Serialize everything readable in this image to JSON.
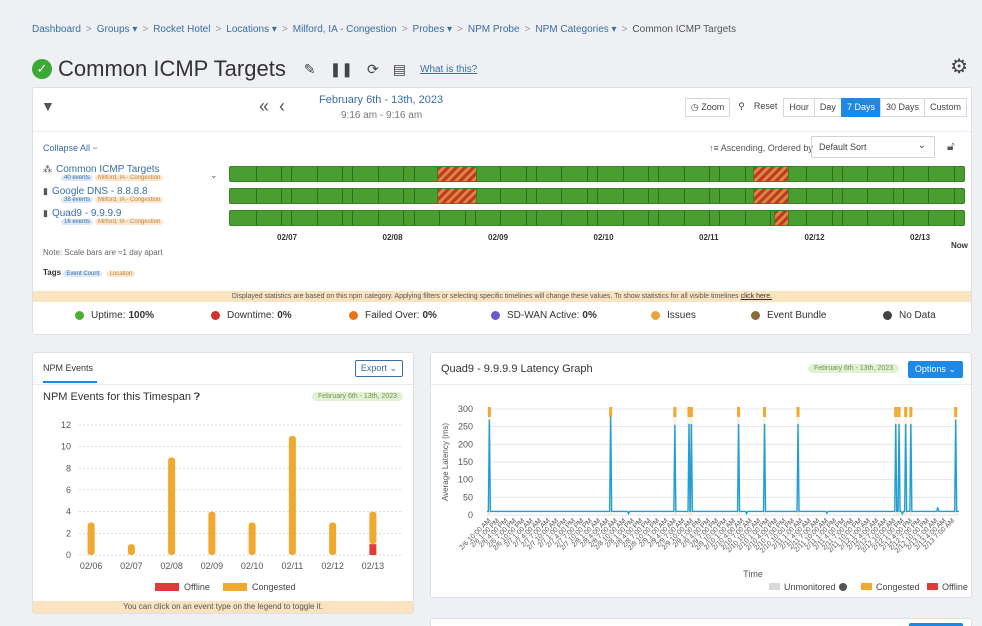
{
  "breadcrumb": [
    {
      "label": "Dashboard",
      "dropdown": false
    },
    {
      "label": "Groups",
      "dropdown": true
    },
    {
      "label": "Rocket Hotel",
      "dropdown": false
    },
    {
      "label": "Locations",
      "dropdown": true
    },
    {
      "label": "Milford, IA - Congestion",
      "dropdown": false
    },
    {
      "label": "Probes",
      "dropdown": true
    },
    {
      "label": "NPM Probe",
      "dropdown": false
    },
    {
      "label": "NPM Categories",
      "dropdown": true
    },
    {
      "label": "Common ICMP Targets",
      "dropdown": false
    }
  ],
  "page": {
    "title": "Common ICMP Targets",
    "what_is_this": "What is this?"
  },
  "timeline": {
    "date_range": "February 6th - 13th, 2023",
    "time_range": "9:16 am - 9:16 am",
    "zoom_label": "Zoom",
    "reset_label": "Reset",
    "ranges": [
      "Hour",
      "Day",
      "7 Days",
      "30 Days",
      "Custom"
    ],
    "active_range": "7 Days",
    "collapse_label": "Collapse All",
    "sort_label": "Ascending, Ordered by",
    "sort_value": "Default Sort",
    "targets": [
      {
        "name": "Common ICMP Targets",
        "events": "40 events",
        "location": "Milford, IA - Congestion",
        "issues": [
          [
            0.282,
            0.336
          ],
          [
            0.712,
            0.761
          ]
        ]
      },
      {
        "name": "Google DNS - 8.8.8.8",
        "events": "38 events",
        "location": "Milford, IA - Congestion",
        "issues": [
          [
            0.282,
            0.336
          ],
          [
            0.712,
            0.761
          ]
        ]
      },
      {
        "name": "Quad9 - 9.9.9.9",
        "events": "16 events",
        "location": "Milford, IA - Congestion",
        "issues": [
          [
            0.741,
            0.761
          ]
        ]
      }
    ],
    "axis_labels": [
      "02/07",
      "02/08",
      "02/09",
      "02/10",
      "02/11",
      "02/12",
      "02/13",
      "Now"
    ],
    "scale_note": "Note: Scale bars are ≈1 day apart",
    "tags_label": "Tags",
    "tag_event_count": "Event Count",
    "tag_location": "Location",
    "banner_text": "Displayed statistics are based on this npm category. Applying filters or selecting specific timelines will change these values. To show statistics for all visible timelines",
    "banner_link": "click here.",
    "stats": [
      {
        "label": "Uptime:",
        "value": "100%",
        "color": "#4caf2f"
      },
      {
        "label": "Downtime:",
        "value": "0%",
        "color": "#d32f2f"
      },
      {
        "label": "Failed Over:",
        "value": "0%",
        "color": "#e8711c"
      },
      {
        "label": "SD-WAN Active:",
        "value": "0%",
        "color": "#6a5acd"
      },
      {
        "label": "Issues",
        "value": "",
        "color": "#e8a33a"
      },
      {
        "label": "Event Bundle",
        "value": "",
        "color": "#8b6a3a"
      },
      {
        "label": "No Data",
        "value": "",
        "color": "#444444"
      }
    ]
  },
  "events_panel": {
    "tab_label": "NPM Events",
    "export_label": "Export",
    "title": "NPM Events for this Timespan",
    "date_pill": "February 6th - 13th, 2023",
    "footer": "You can click on an event type on the legend to toggle it."
  },
  "latency_panel": {
    "title": "Quad9 - 9.9.9.9 Latency Graph",
    "date_pill": "February 6th - 13th, 2023",
    "options_label": "Options"
  },
  "chart_data": [
    {
      "type": "bar",
      "title": "NPM Events for this Timespan",
      "categories": [
        "02/06",
        "02/07",
        "02/08",
        "02/09",
        "02/10",
        "02/11",
        "02/12",
        "02/13"
      ],
      "series": [
        {
          "name": "Offline",
          "color": "#e03a3a",
          "values": [
            0,
            0,
            0,
            0,
            0,
            0,
            0,
            1
          ]
        },
        {
          "name": "Congested",
          "color": "#f0a92e",
          "values": [
            3,
            1,
            9,
            4,
            3,
            11,
            3,
            3
          ]
        }
      ],
      "ylim": [
        0,
        12
      ],
      "yticks": [
        0,
        2,
        4,
        6,
        8,
        10,
        12
      ],
      "stacked": true,
      "legend": "bottom",
      "grid": true
    },
    {
      "type": "line",
      "title": "Quad9 - 9.9.9.9 Latency Graph",
      "xlabel": "Time",
      "ylabel": "Average Latency (ms)",
      "ylim": [
        0,
        300
      ],
      "yticks": [
        0,
        50,
        100,
        150,
        200,
        250,
        300
      ],
      "x_ticks": [
        "2/6 10:00 AM",
        "2/6 1:00 PM",
        "2/6 4:00 PM",
        "2/6 7:00 PM",
        "2/6 10:00 PM",
        "2/7 1:00 AM",
        "2/7 4:00 AM",
        "2/7 7:00 AM",
        "2/7 10:00 AM",
        "2/7 1:00 PM",
        "2/7 4:00 PM",
        "2/7 7:00 PM",
        "2/7 10:00 PM",
        "2/8 1:00 AM",
        "2/8 4:00 AM",
        "2/8 7:00 AM",
        "2/8 10:00 AM",
        "2/8 1:00 PM",
        "2/8 4:00 PM",
        "2/8 7:00 PM",
        "2/8 10:00 PM",
        "2/9 1:00 AM",
        "2/9 4:00 AM",
        "2/9 7:00 AM",
        "2/9 10:00 AM",
        "2/9 1:00 PM",
        "2/9 4:00 PM",
        "2/9 7:00 PM",
        "2/9 10:00 PM",
        "2/10 1:00 AM",
        "2/10 4:00 AM",
        "2/10 7:00 AM",
        "2/10 10:00 AM",
        "2/10 1:00 PM",
        "2/10 4:00 PM",
        "2/10 7:00 PM",
        "2/10 10:00 PM",
        "2/11 1:00 AM",
        "2/11 4:00 AM",
        "2/11 7:00 AM",
        "2/11 10:00 AM",
        "2/11 1:00 PM",
        "2/11 4:00 PM",
        "2/11 7:00 PM",
        "2/11 10:00 PM",
        "2/12 1:00 AM",
        "2/12 4:00 AM",
        "2/12 7:00 AM",
        "2/12 10:00 AM",
        "2/12 1:00 PM",
        "2/12 4:00 PM",
        "2/12 7:00 PM",
        "2/12 10:00 PM",
        "2/13 1:00 AM",
        "2/13 4:00 AM",
        "2/13 7:00 AM"
      ],
      "baseline_ms": 10,
      "spikes": [
        {
          "t": 0.005,
          "ms": 270
        },
        {
          "t": 0.262,
          "ms": 278
        },
        {
          "t": 0.398,
          "ms": 255
        },
        {
          "t": 0.428,
          "ms": 258
        },
        {
          "t": 0.433,
          "ms": 258
        },
        {
          "t": 0.533,
          "ms": 258
        },
        {
          "t": 0.588,
          "ms": 258
        },
        {
          "t": 0.659,
          "ms": 258
        },
        {
          "t": 0.866,
          "ms": 258
        },
        {
          "t": 0.873,
          "ms": 258
        },
        {
          "t": 0.887,
          "ms": 258
        },
        {
          "t": 0.898,
          "ms": 258
        },
        {
          "t": 0.993,
          "ms": 270
        }
      ],
      "dips": [
        {
          "t": 0.3,
          "ms": 4
        },
        {
          "t": 0.55,
          "ms": 4
        },
        {
          "t": 0.72,
          "ms": 5
        },
        {
          "t": 0.88,
          "ms": 3
        }
      ],
      "tail_blip": {
        "t": 0.955,
        "ms": 22
      },
      "series_colors": {
        "latency": "#1e9fd8"
      },
      "legend": [
        {
          "name": "Unmonitored",
          "color": "#d9d9d9"
        },
        {
          "name": "Congested",
          "color": "#f0a92e"
        },
        {
          "name": "Offline",
          "color": "#e03a3a"
        }
      ]
    }
  ]
}
